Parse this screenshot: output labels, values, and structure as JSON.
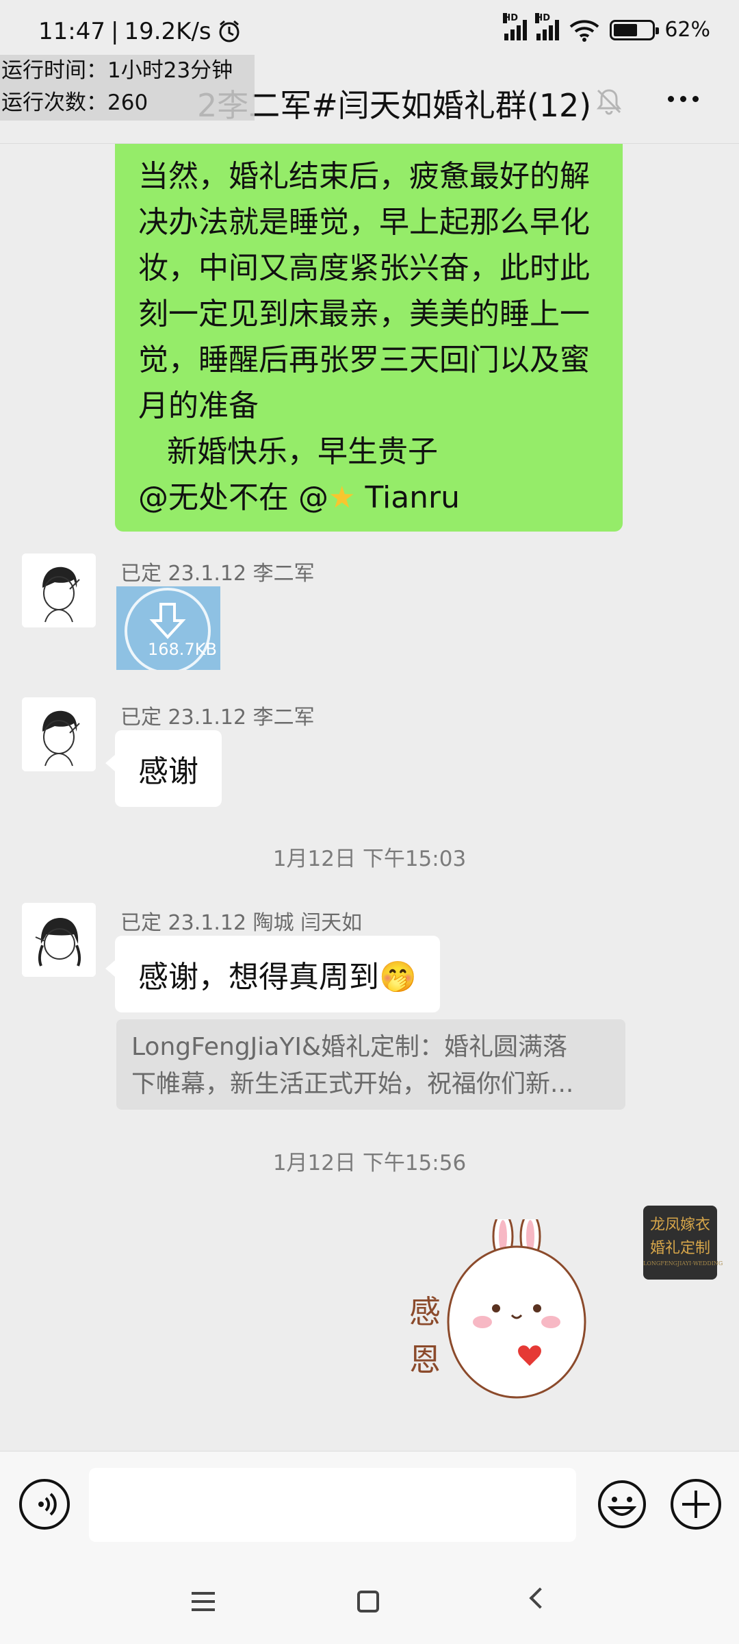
{
  "status_bar": {
    "time": "11:47",
    "speed": "19.2K/s",
    "signal_label_1": "HD",
    "signal_label_2": "HD",
    "battery_percent": "62%",
    "battery_level": 0.62
  },
  "overlay": {
    "run_time": "运行时间：1小时23分钟",
    "run_count": "运行次数：260"
  },
  "header": {
    "title": "2李二军#闫天如婚礼群(12)",
    "muted": true
  },
  "messages": [
    {
      "type": "text-green",
      "lines": [
        "当然，婚礼结束后，疲惫最好的解",
        "决办法就是睡觉，早上起那么早化",
        "妆，中间又高度紧张兴奋，此时此",
        "刻一定见到床最亲，美美的睡上一",
        "觉，睡醒后再张罗三天回门以及蜜",
        "月的准备",
        "   新婚快乐，早生贵子"
      ],
      "mention_prefix": "@无处不在  @",
      "mention_suffix": " Tianru"
    },
    {
      "type": "image",
      "sender": "已定 23.1.12 李二军",
      "size": "168.7KB"
    },
    {
      "type": "text",
      "sender": "已定 23.1.12 李二军",
      "text": "感谢"
    },
    {
      "type": "time",
      "text": "1月12日 下午15:03"
    },
    {
      "type": "text-quote",
      "sender": "已定  23.1.12 陶城 闫天如",
      "text": "感谢，想得真周到🤭",
      "quote_line1": "LongFengJiaYI&婚礼定制：婚礼圆满落",
      "quote_line2": "下帷幕，新生活正式开始，祝福你们新..."
    },
    {
      "type": "time",
      "text": "1月12日 下午15:56"
    },
    {
      "type": "sticker",
      "sticker_text_1": "感",
      "sticker_text_2": "恩"
    }
  ],
  "shop_logo": {
    "line1": "龙凤嫁衣",
    "line2": "婚礼定制",
    "small": "LONGFENGJIAYI·WEDDING"
  },
  "input": {
    "placeholder": "",
    "value": ""
  },
  "icons": {
    "voice": "voice-icon",
    "emoji": "emoji-icon",
    "plus": "plus-icon",
    "mute": "mute-bell-icon",
    "more": "more-icon",
    "nav_menu": "menu-icon",
    "nav_home": "home-icon",
    "nav_back": "back-icon"
  },
  "colors": {
    "bg": "#ededed",
    "green_bubble": "#95ec69",
    "white_bubble": "#ffffff",
    "quote_bg": "#e0e0e0"
  }
}
